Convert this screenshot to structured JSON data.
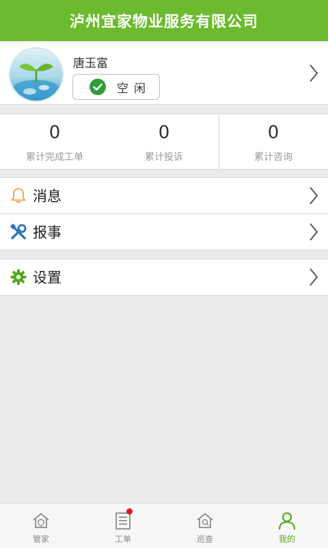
{
  "header": {
    "title": "泸州宜家物业服务有限公司"
  },
  "profile": {
    "name": "唐玉富",
    "status": "空闲"
  },
  "stats": [
    {
      "value": "0",
      "label": "累计完成工单"
    },
    {
      "value": "0",
      "label": "累计投诉"
    },
    {
      "value": "0",
      "label": "累计咨询"
    }
  ],
  "menu": {
    "messages": "消息",
    "report": "报事",
    "settings": "设置"
  },
  "tabs": [
    {
      "label": "管家",
      "active": false
    },
    {
      "label": "工单",
      "active": false,
      "badge": true
    },
    {
      "label": "巡查",
      "active": false
    },
    {
      "label": "我的",
      "active": true
    }
  ],
  "colors": {
    "brand": "#6cba2e",
    "status_check": "#2e9d3a",
    "bell": "#f0a040",
    "tool": "#2f77b8",
    "gear": "#55a81e",
    "badge": "#e8161a"
  }
}
